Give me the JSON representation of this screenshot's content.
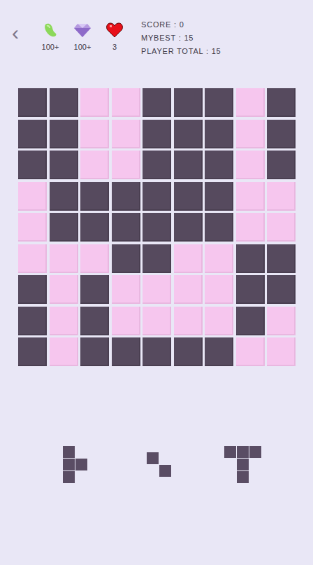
{
  "header": {
    "back": "‹",
    "resources": [
      {
        "kind": "bean",
        "count": "100+"
      },
      {
        "kind": "gem",
        "count": "100+"
      },
      {
        "kind": "heart",
        "count": "3"
      }
    ],
    "stats": [
      "SCORE : 0",
      "MYBEST : 15",
      "PLAYER TOTAL : 15"
    ]
  },
  "grid": {
    "rows": [
      [
        true,
        true,
        false,
        false,
        true,
        true,
        true,
        false,
        true
      ],
      [
        true,
        true,
        false,
        false,
        true,
        true,
        true,
        false,
        true
      ],
      [
        true,
        true,
        false,
        false,
        true,
        true,
        true,
        false,
        true
      ],
      [
        false,
        true,
        true,
        true,
        true,
        true,
        true,
        false,
        false
      ],
      [
        false,
        true,
        true,
        true,
        true,
        true,
        true,
        false,
        false
      ],
      [
        false,
        false,
        false,
        true,
        true,
        false,
        false,
        true,
        true
      ],
      [
        true,
        false,
        true,
        false,
        false,
        false,
        false,
        true,
        true
      ],
      [
        true,
        false,
        true,
        false,
        false,
        false,
        false,
        true,
        false
      ],
      [
        true,
        false,
        true,
        true,
        true,
        true,
        true,
        false,
        false
      ]
    ]
  },
  "pieces": [
    {
      "cells": [
        [
          true,
          false
        ],
        [
          true,
          true
        ],
        [
          true,
          false
        ]
      ]
    },
    {
      "cells": [
        [
          true,
          false
        ],
        [
          false,
          true
        ]
      ]
    },
    {
      "cells": [
        [
          true,
          true,
          true
        ],
        [
          false,
          true,
          false
        ],
        [
          false,
          true,
          false
        ]
      ]
    }
  ]
}
